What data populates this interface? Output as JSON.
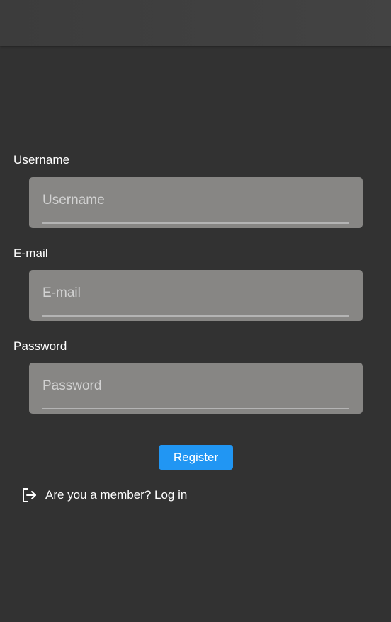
{
  "register_form": {
    "username": {
      "label": "Username",
      "placeholder": "Username",
      "value": ""
    },
    "email": {
      "label": "E-mail",
      "placeholder": "E-mail",
      "value": ""
    },
    "password": {
      "label": "Password",
      "placeholder": "Password",
      "value": ""
    },
    "register_label": "Register",
    "login_link_text": "Are you a member? Log in",
    "login_icon": "logout-arrow-icon"
  },
  "colors": {
    "background": "#323232",
    "app_bar": "#3f3f3f",
    "input_fill": "#878684",
    "accent": "#2196f3"
  }
}
